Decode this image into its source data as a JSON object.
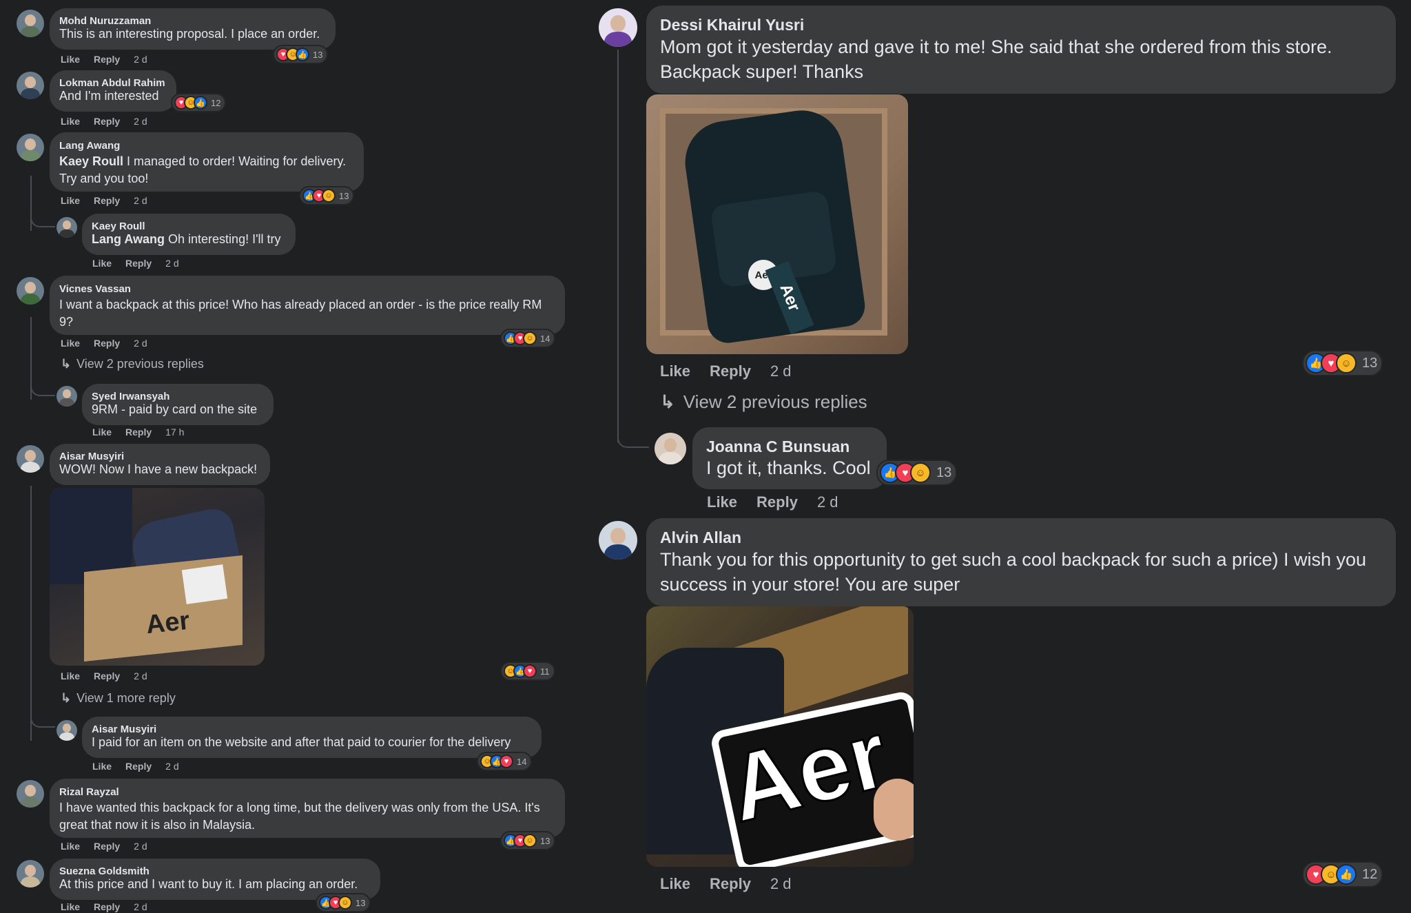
{
  "actions": {
    "like": "Like",
    "reply": "Reply"
  },
  "left": [
    {
      "name": "Mohd Nuruzzaman",
      "text": "This is an interesting proposal. I place an order.",
      "time": "2 d",
      "count": "13"
    },
    {
      "name": "Lokman Abdul Rahim",
      "text": "And I'm interested",
      "time": "2 d",
      "count": "12"
    },
    {
      "name": "Lang Awang",
      "mention": "Kaey Roull",
      "text": " I managed to order! Waiting for delivery. Try and you too!",
      "time": "2 d",
      "count": "13"
    },
    {
      "name": "Kaey Roull",
      "mention": "Lang Awang",
      "text": " Oh interesting! I'll try",
      "time": "2 d"
    },
    {
      "name": "Vicnes Vassan",
      "text": "I want a backpack at this price! Who has already placed an order - is the price really RM 9?",
      "time": "2 d",
      "count": "14"
    },
    {
      "name": "Syed Irwansyah",
      "text": "9RM - paid by card on the site",
      "time": "17 h"
    },
    {
      "name": "Aisar Musyiri",
      "text": "WOW! Now I have a new backpack!",
      "time": "2 d",
      "count": "11",
      "photo_label": "Aer"
    },
    {
      "name": "Aisar Musyiri",
      "text": "I paid for an item on the website and after that paid to courier for the delivery",
      "time": "2 d",
      "count": "14"
    },
    {
      "name": "Rizal Rayzal",
      "text": "I have wanted this backpack for a long time, but the delivery was only from the USA. It's great that now it is also in Malaysia.",
      "time": "2 d",
      "count": "13"
    },
    {
      "name": "Suezna Goldsmith",
      "text": "At this price and I want to buy it. I am placing an order.",
      "time": "2 d",
      "count": "13"
    }
  ],
  "left_more": {
    "vicnes": "View 2 previous replies",
    "aisar": "View 1 more reply"
  },
  "right": [
    {
      "name": "Dessi Khairul Yusri",
      "text": "Mom got it yesterday and gave it to me! She said that she ordered from this store. Backpack super! Thanks",
      "time": "2 d",
      "count": "13",
      "photo_label": "Aer"
    },
    {
      "name": "Joanna C Bunsuan",
      "text": "I got it, thanks. Cool",
      "time": "2 d",
      "count": "13"
    },
    {
      "name": "Alvin Allan",
      "text": "Thank you for this opportunity to get such a cool backpack for such a price) I wish you success in your store! You are super",
      "time": "2 d",
      "count": "12",
      "photo_label": "Aer"
    }
  ],
  "right_more": {
    "dessi": "View 2 previous replies"
  },
  "colors": {
    "background": "#1e2022",
    "bubble": "#3a3b3c",
    "like": "#1877f2",
    "love": "#f33e58",
    "care": "#f7b928"
  },
  "icons": {
    "like": "thumbs-up-icon",
    "love": "heart-icon",
    "care": "care-emoji-icon",
    "reply_arrow": "reply-arrow-icon"
  }
}
